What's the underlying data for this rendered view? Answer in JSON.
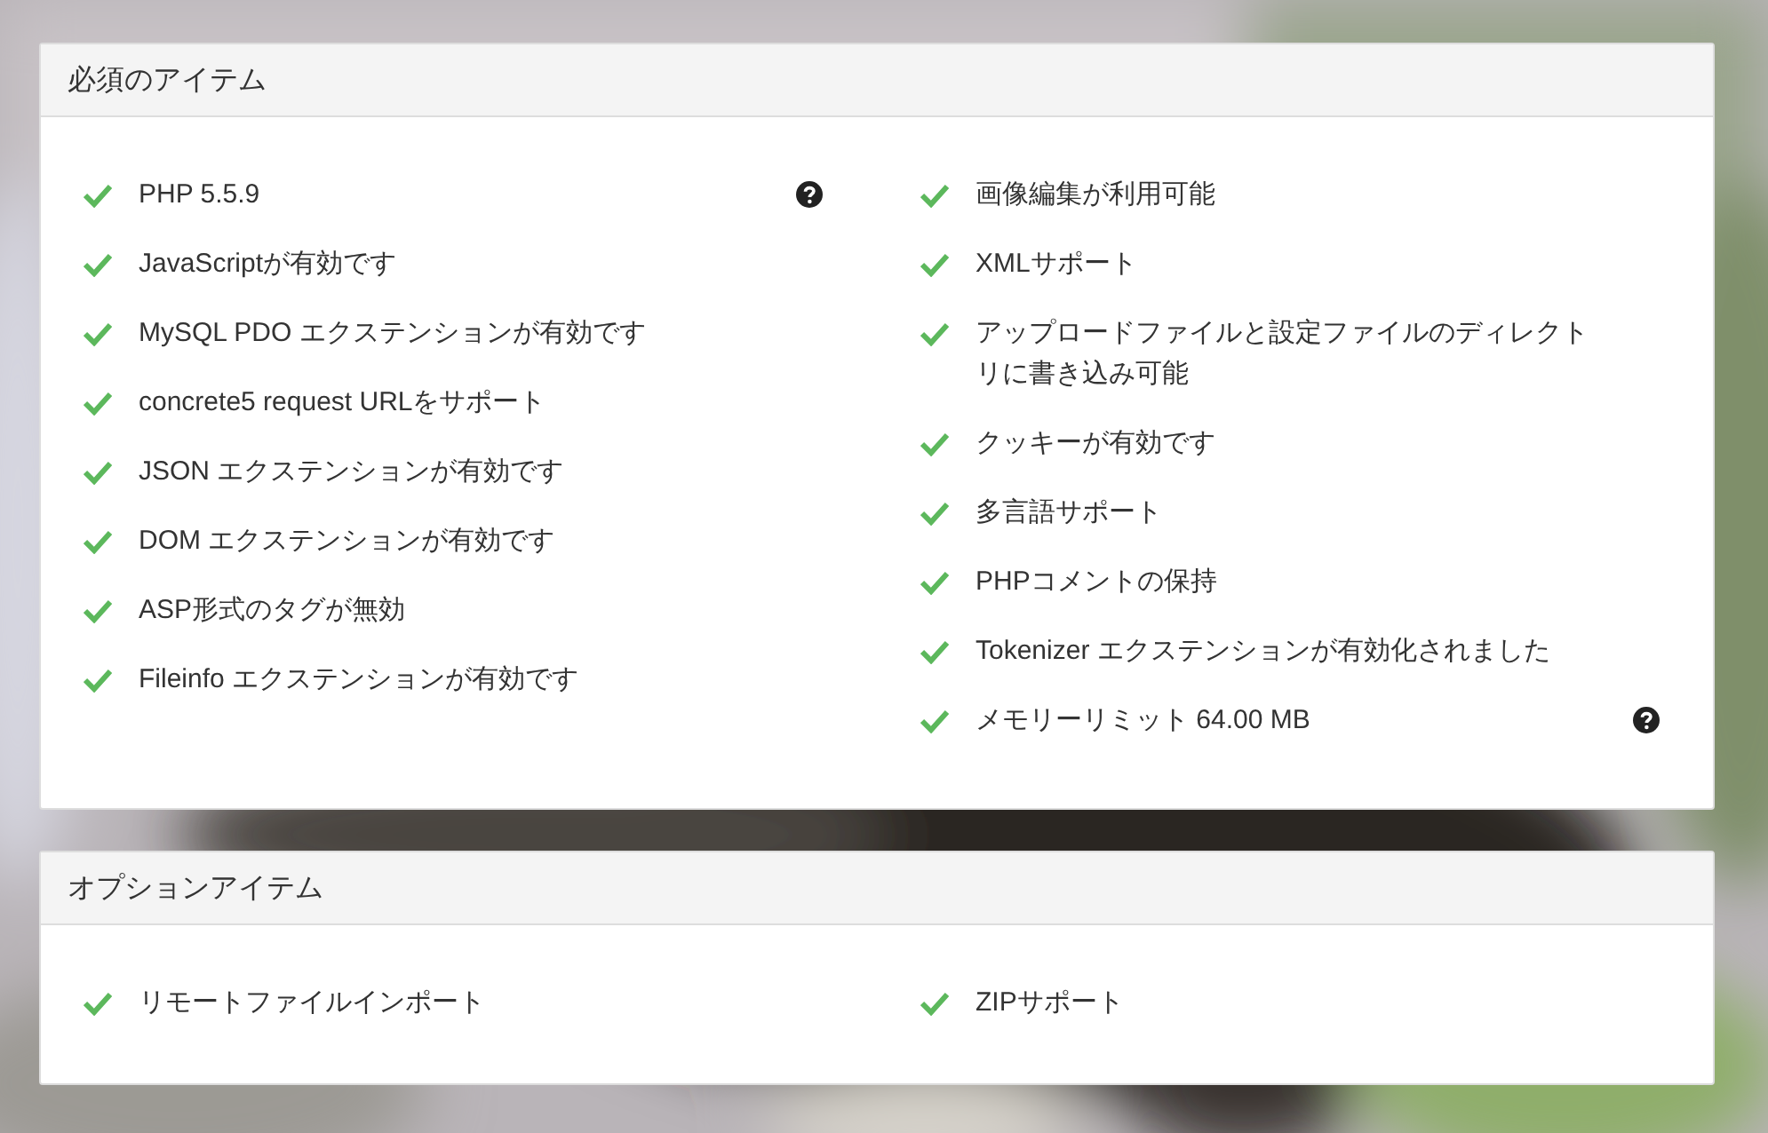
{
  "panels": [
    {
      "title": "必須のアイテム",
      "columns": [
        [
          {
            "label": "PHP 5.5.9",
            "passed": true,
            "help": true
          },
          {
            "label": "JavaScriptが有効です",
            "passed": true,
            "help": false
          },
          {
            "label": "MySQL PDO エクステンションが有効です",
            "passed": true,
            "help": false
          },
          {
            "label": "concrete5 request URLをサポート",
            "passed": true,
            "help": false
          },
          {
            "label": "JSON エクステンションが有効です",
            "passed": true,
            "help": false
          },
          {
            "label": "DOM エクステンションが有効です",
            "passed": true,
            "help": false
          },
          {
            "label": "ASP形式のタグが無効",
            "passed": true,
            "help": false
          },
          {
            "label": "Fileinfo エクステンションが有効です",
            "passed": true,
            "help": false
          }
        ],
        [
          {
            "label": "画像編集が利用可能",
            "passed": true,
            "help": false
          },
          {
            "label": "XMLサポート",
            "passed": true,
            "help": false
          },
          {
            "label": "アップロードファイルと設定ファイルのディレクトリに書き込み可能",
            "passed": true,
            "help": false
          },
          {
            "label": "クッキーが有効です",
            "passed": true,
            "help": false
          },
          {
            "label": "多言語サポート",
            "passed": true,
            "help": false
          },
          {
            "label": "PHPコメントの保持",
            "passed": true,
            "help": false
          },
          {
            "label": "Tokenizer エクステンションが有効化されました",
            "passed": true,
            "help": false
          },
          {
            "label": "メモリーリミット 64.00 MB",
            "passed": true,
            "help": true
          }
        ]
      ]
    },
    {
      "title": "オプションアイテム",
      "columns": [
        [
          {
            "label": "リモートファイルインポート",
            "passed": true,
            "help": false
          }
        ],
        [
          {
            "label": "ZIPサポート",
            "passed": true,
            "help": false
          }
        ]
      ]
    }
  ]
}
